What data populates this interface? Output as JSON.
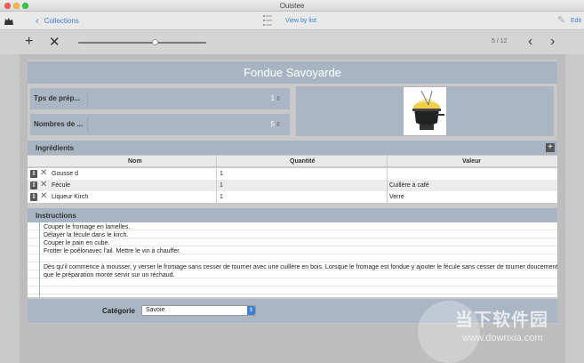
{
  "window": {
    "title": "Ouistee"
  },
  "toolbar": {
    "back_label": "Collections",
    "view_label": "View by list",
    "edit_label": "Edit",
    "pager": "5 / 12",
    "slider_fraction": 0.6
  },
  "recipe": {
    "title": "Fondue Savoyarde",
    "fields": [
      {
        "label": "Tps de prép...",
        "value": "1"
      },
      {
        "label": "Nombres de ...",
        "value": "5"
      }
    ]
  },
  "ingredients": {
    "title": "Ingrédients",
    "columns": [
      "Nom",
      "Quantité",
      "Valeur"
    ],
    "rows": [
      {
        "nom": "Gousse d",
        "quantite": "1",
        "valeur": ""
      },
      {
        "nom": "Fécule",
        "quantite": "1",
        "valeur": "Cuillère à café"
      },
      {
        "nom": "Liqueur Kirch",
        "quantite": "1",
        "valeur": "Verre"
      }
    ]
  },
  "instructions": {
    "title": "Instructions",
    "lines": [
      "Couper le fromage en lamelles.",
      "Délayer la fécule dans le kirch.",
      "Couper le pain en cube.",
      "Frotter le poêlonavec l'ail. Mettre le vin à chauffer.",
      "",
      "Dès qu'il commence à mousser, y verser le fromage sans cesser de tourner avec une cuillère en bois. Lorsque le fromage est fondue y ajouter le fécule sans cesser de tourner doucement. Dès",
      "que le préparation monte servir sur un réchaud."
    ]
  },
  "category": {
    "label": "Catégorie",
    "selected": "Savoie"
  },
  "watermark": {
    "text": "当下软件园",
    "url": "www.downxia.com"
  },
  "colors": {
    "accent": "#3b7fd6",
    "section": "#a8b4c2",
    "field": "#aab6c4"
  }
}
